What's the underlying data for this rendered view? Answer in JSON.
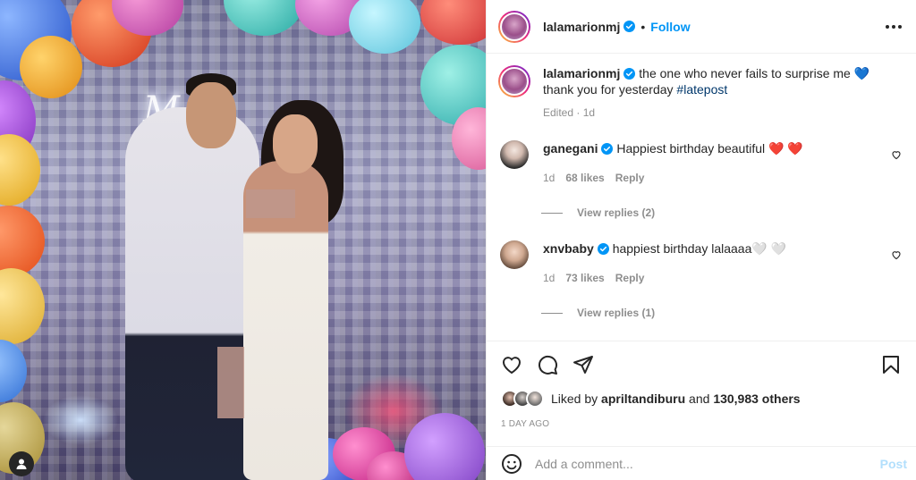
{
  "post": {
    "author": "lalamarionmj",
    "follow_label": "Follow",
    "dot": "•",
    "neon_text": "M G"
  },
  "caption": {
    "username": "lalamarionmj",
    "text_before_tag": " the one who never fails to surprise me 💙 thank you for yesterday ",
    "hashtag": "#latepost",
    "meta": "Edited · 1d"
  },
  "comments": [
    {
      "username": "ganegani",
      "text": " Happiest birthday beautiful ❤️ ❤️",
      "time": "1d",
      "likes": "68 likes",
      "reply_label": "Reply",
      "view_replies": "View replies (2)"
    },
    {
      "username": "xnvbaby",
      "text": " happiest birthday lalaaaa🤍 🤍",
      "time": "1d",
      "likes": "73 likes",
      "reply_label": "Reply",
      "view_replies": "View replies (1)"
    }
  ],
  "likes": {
    "liked_by": "Liked by ",
    "liker": "apriltandiburu",
    "and": " and ",
    "others": "130,983 others"
  },
  "time_ago": "1 day ago",
  "add_comment": {
    "placeholder": "Add a comment...",
    "post_label": "Post"
  },
  "colors": {
    "accent": "#0095f6",
    "verified": "#0095f6",
    "heart_red": "#ed4956"
  },
  "icons": [
    "verified-icon",
    "more-icon",
    "heart-icon",
    "comment-icon",
    "share-icon",
    "bookmark-icon",
    "emoji-icon",
    "user-tag-icon"
  ]
}
